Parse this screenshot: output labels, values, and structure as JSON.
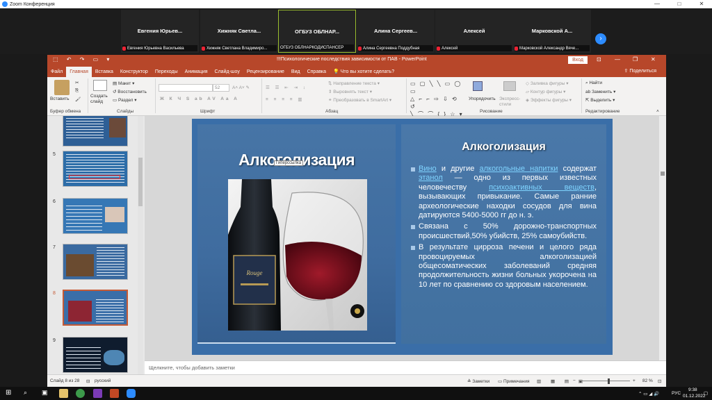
{
  "zoom": {
    "title": "Zoom Конференция",
    "controls": {
      "minimize": "—",
      "maximize": "□",
      "close": "✕"
    },
    "participants": [
      {
        "name": "Евгения  Юрьев...",
        "caption": "Евгения Юрьевна Васильева"
      },
      {
        "name": "Хижняк  Светла...",
        "caption": "Хижняк Светлана Владимиро..."
      },
      {
        "name": "ОГБУЗ  ОБЛНАР...",
        "caption": "ОГБУЗ ОБЛНАРКОДИСПАНСЕР"
      },
      {
        "name": "Алина  Сергеев...",
        "caption": "Алина Сергеевна Поддубная"
      },
      {
        "name": "Алексей",
        "caption": "Алексей"
      },
      {
        "name": "Марковской  А...",
        "caption": "Марковской Александр Вяче..."
      }
    ],
    "next_icon": "chevron-right-icon"
  },
  "ppt": {
    "doc_title": "!!!Психологические последствия зависимости от ПАВ  -  PowerPoint",
    "login_label": "Вход",
    "qat": "⬚ ↶ ↷ ▭ ▾",
    "menu_tabs": [
      "Файл",
      "Главная",
      "Вставка",
      "Конструктор",
      "Переходы",
      "Анимация",
      "Слайд-шоу",
      "Рецензирование",
      "Вид",
      "Справка",
      "Что вы хотите сделать?"
    ],
    "active_tab": "Главная",
    "share_label": "Поделиться",
    "ribbon": {
      "paste": "Вставить",
      "clipboard_group": "Буфер обмена",
      "new_slide": "Создать слайд",
      "layout": "Макет",
      "reset": "Восстановить",
      "section": "Раздел",
      "slides_group": "Слайды",
      "font_name": "",
      "font_size": "52",
      "font_group": "Шрифт",
      "text_direction": "Направление текста",
      "align_text": "Выровнять текст",
      "smartart": "Преобразовать в SmartArt",
      "paragraph_group": "Абзац",
      "arrange": "Упорядочить",
      "quick_styles": "Экспресс-стили",
      "shape_fill": "Заливка фигуры",
      "shape_outline": "Контур фигуры",
      "shape_effects": "Эффекты фигуры",
      "drawing_group": "Рисование",
      "find": "Найти",
      "replace": "Заменить",
      "select": "Выделить",
      "editing_group": "Редактирование"
    },
    "thumbnails": [
      {
        "num": "",
        "label": ""
      },
      {
        "num": "5",
        "label": ""
      },
      {
        "num": "6",
        "label": ""
      },
      {
        "num": "7",
        "label": ""
      },
      {
        "num": "8",
        "label": ""
      },
      {
        "num": "9",
        "label": ""
      }
    ],
    "slide": {
      "title_left": "Алкоголизация",
      "tooltip": "Гиперссылка",
      "title_right": "Алкоголизация",
      "bullet1": {
        "w1": "Вино",
        "t1": " и другие ",
        "w2": "алкогольные напитки",
        "t2": " содержат ",
        "w3": "этанол",
        "t3": " — одно из первых известных человечеству ",
        "w4": "психоактивных веществ",
        "t4": ", вызывающих привыкание. Самые ранние археологические находки сосудов для вина датируются 5400-5000 гг до н. э."
      },
      "bullet2": "Связана с 50% дорожно-транспортных происшествий,50% убийств, 25% самоубийств.",
      "bullet3": "В результате цирроза печени и целого ряда провоцируемых алкоголизацией общесоматических заболеваний средняя продолжительность жизни больных укорочена на 10 лет по сравнению со здоровым населением."
    },
    "notes_placeholder": "Щелкните, чтобы добавить заметки",
    "status": {
      "slide_info": "Слайд 8 из 28",
      "language": "русский",
      "notes": "Заметки",
      "comments": "Примечания",
      "zoom": "82 %"
    }
  },
  "taskbar": {
    "lang": "РУС",
    "time": "9:38",
    "date": "01.12.2022"
  }
}
